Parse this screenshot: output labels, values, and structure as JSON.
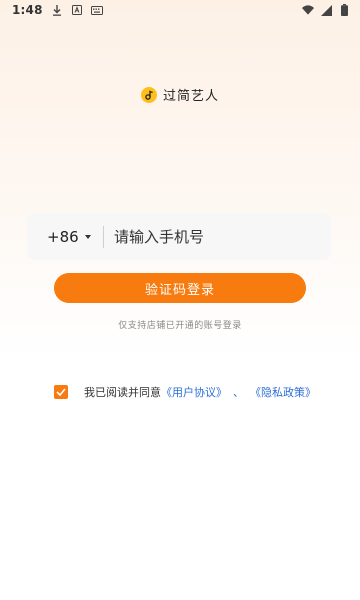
{
  "status_bar": {
    "time": "1:48",
    "icons": [
      "download-icon",
      "a-icon",
      "keyboard-icon",
      "wifi-icon",
      "signal-icon",
      "battery-icon"
    ]
  },
  "brand": {
    "name": "过简艺人",
    "logo_icon": "music-note-icon",
    "logo_color": "#ffbf1a"
  },
  "login": {
    "country_code": "+86",
    "phone_placeholder": "请输入手机号",
    "phone_value": "",
    "button_label": "验证码登录",
    "hint": "仅支持店铺已开通的账号登录"
  },
  "agreement": {
    "checked": true,
    "prefix": "我已阅读并同意",
    "user_agreement": "《用户协议》",
    "separator": "、",
    "privacy_policy": "《隐私政策》"
  },
  "colors": {
    "accent": "#f77b0f",
    "link": "#2c6fd6"
  }
}
